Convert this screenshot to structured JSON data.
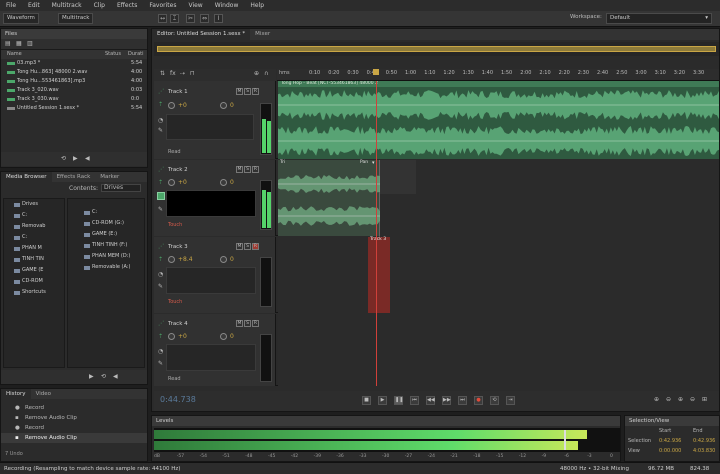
{
  "menu": [
    "File",
    "Edit",
    "Multitrack",
    "Clip",
    "Effects",
    "Favorites",
    "View",
    "Window",
    "Help"
  ],
  "toolbar": {
    "waveform": "Waveform",
    "multitrack": "Multitrack",
    "workspace_label": "Workspace:",
    "workspace_value": "Default"
  },
  "files": {
    "title": "Files",
    "col_name": "Name",
    "col_status": "Status",
    "col_duration": "Durati",
    "items": [
      {
        "name": "03.mp3 *",
        "duration": "5:54"
      },
      {
        "name": "Tong Hu...863] 48000 2.wav",
        "duration": "4:00"
      },
      {
        "name": "Tong Hu...553461863].mp3",
        "duration": "4:00"
      },
      {
        "name": "Track 3_020.wav",
        "duration": "0:03"
      },
      {
        "name": "Track 3_030.wav",
        "duration": "0:0"
      },
      {
        "name": "Untitled Session 1.sesx *",
        "duration": "5:54"
      }
    ]
  },
  "media": {
    "tabs": [
      "Media Browser",
      "Effects Rack",
      "Marker"
    ],
    "contents_label": "Contents:",
    "contents_value": "Drives",
    "left_tree": [
      "Drives",
      "C:",
      "Removab",
      "C:",
      "PHAN M",
      "TINH TIN",
      "GAME (E",
      "CD-ROM",
      "Shortcuts"
    ],
    "right_tree": [
      "C:",
      "CD-ROM (G:)",
      "GAME (E:)",
      "TINH TINH (F:)",
      "PHAN MEM (D:)",
      "Removable (A:)"
    ]
  },
  "history": {
    "tabs": [
      "History",
      "Video"
    ],
    "items": [
      "Record",
      "Remove Audio Clip",
      "Record",
      "Remove Audio Clip"
    ],
    "undo": "7 Undo"
  },
  "editor": {
    "tab": "Editor: Untitled Session 1.sesx *",
    "tab2": "Mixer",
    "ruler_label": "hms",
    "ruler": [
      "0:10",
      "0:20",
      "0:30",
      "0:40",
      "0:50",
      "1:00",
      "1:10",
      "1:20",
      "1:30",
      "1:40",
      "1:50",
      "2:00",
      "2:10",
      "2:20",
      "2:30",
      "2:40",
      "2:50",
      "3:00",
      "3:10",
      "3:20",
      "3:30"
    ],
    "time": "0:44.738",
    "tracks": [
      {
        "name": "Track 1",
        "vol": "+0",
        "pan": "0",
        "mode": "Read",
        "clip": "Tong Hop - Beat [NCT-553461863] 48000 2"
      },
      {
        "name": "Track 2",
        "vol": "+0",
        "pan": "0",
        "mode": "Touch",
        "clip_a": "Tri",
        "clip_b": "Pan"
      },
      {
        "name": "Track 3",
        "vol": "+8.4",
        "pan": "0",
        "mode": "Touch",
        "clip": "Track 3"
      },
      {
        "name": "Track 4",
        "vol": "+0",
        "pan": "0",
        "mode": "Read",
        "clip": ""
      }
    ]
  },
  "levels": {
    "title": "Levels",
    "scale": [
      "dB",
      "-57",
      "-54",
      "-51",
      "-48",
      "-45",
      "-42",
      "-39",
      "-36",
      "-33",
      "-30",
      "-27",
      "-24",
      "-21",
      "-18",
      "-15",
      "-12",
      "-9",
      "-6",
      "-3",
      "0"
    ],
    "left_level": 0.93,
    "right_level": 0.91
  },
  "selection": {
    "title": "Selection/View",
    "col_start": "Start",
    "col_end": "End",
    "row1": "Selection",
    "row2": "View",
    "sel_start": "0:42.936",
    "sel_end": "0:42.936",
    "view_start": "0:00.000",
    "view_end": "4:03.830"
  },
  "status": {
    "left": "Recording (Resampling to match device sample rate: 44100 Hz)",
    "rate": "48000 Hz • 32-bit Mixing",
    "mem": "96.72 MB",
    "disk": "824.38"
  },
  "colors": {
    "wave": "#3f8a5e",
    "accent": "#c9a645",
    "playhead": "#d0403a"
  }
}
